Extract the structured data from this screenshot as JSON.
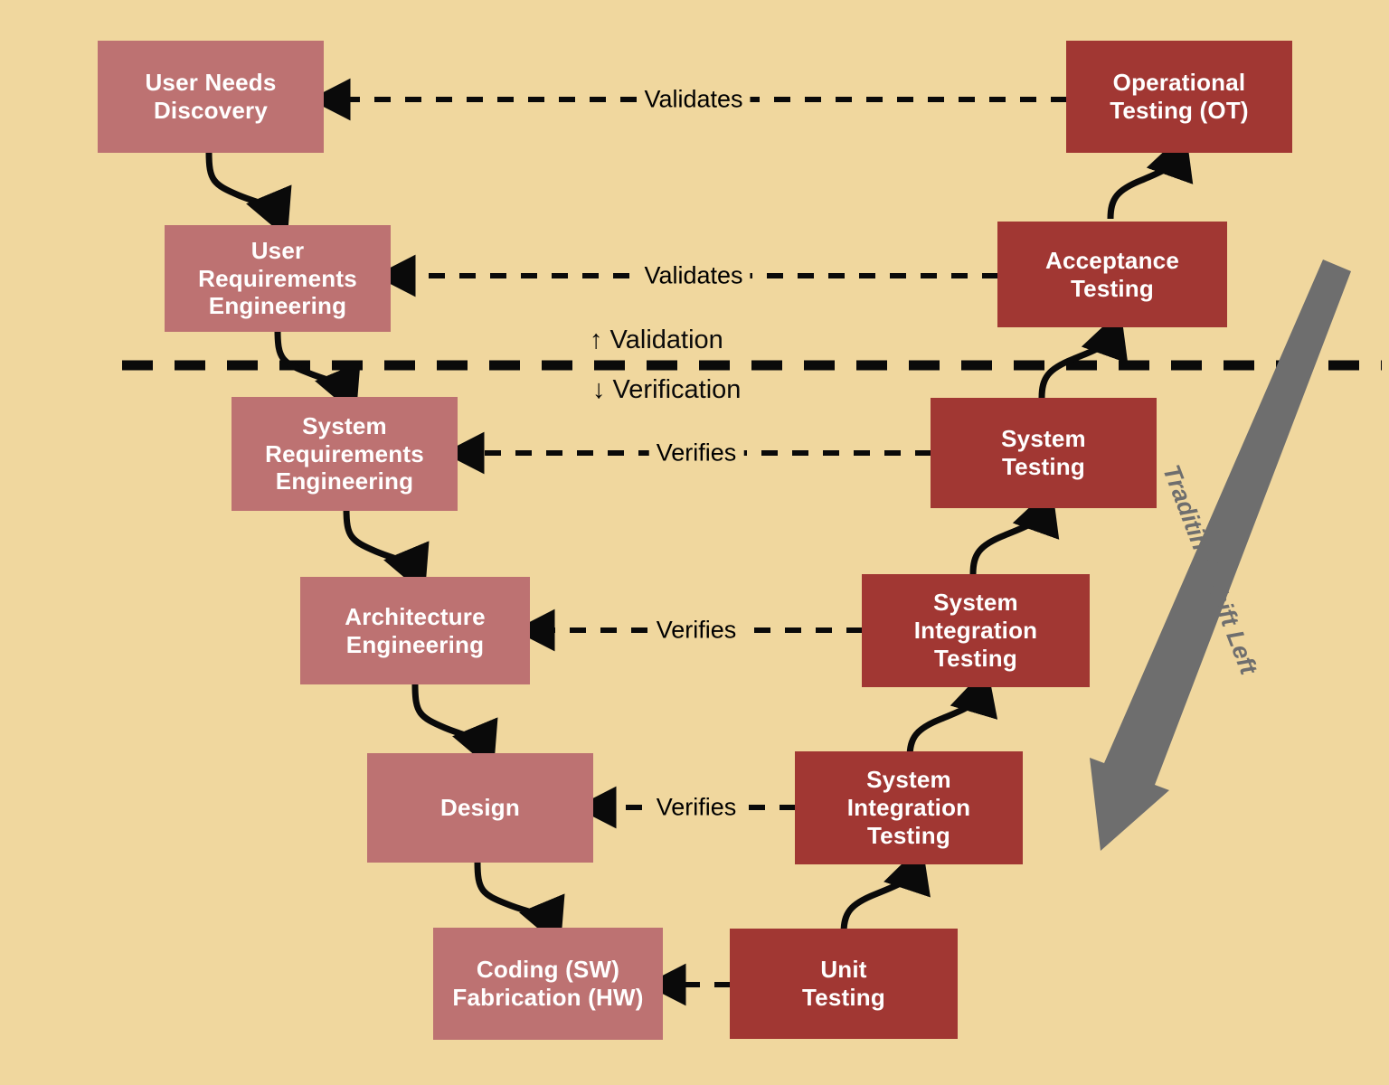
{
  "diagram": {
    "title_label": "",
    "background_color": "#f0d79e",
    "left_node_color": "#bd7272",
    "right_node_color": "#a13733",
    "arrow_color": "#0a0a0a",
    "shift_arrow_color": "#6e6e6e",
    "divider": {
      "above_label": "↑  Validation",
      "below_label": "↓ Verification"
    },
    "left_nodes": [
      {
        "id": "user-needs-discovery",
        "label": "User Needs\nDiscovery"
      },
      {
        "id": "user-requirements-engineering",
        "label": "User\nRequirements\nEngineering"
      },
      {
        "id": "system-requirements-engineering",
        "label": "System\nRequirements\nEngineering"
      },
      {
        "id": "architecture-engineering",
        "label": "Architecture\nEngineering"
      },
      {
        "id": "design",
        "label": "Design"
      },
      {
        "id": "coding-fabrication",
        "label": "Coding (SW)\nFabrication (HW)"
      }
    ],
    "right_nodes": [
      {
        "id": "operational-testing",
        "label": "Operational\nTesting (OT)"
      },
      {
        "id": "acceptance-testing",
        "label": "Acceptance\nTesting"
      },
      {
        "id": "system-testing",
        "label": "System\nTesting"
      },
      {
        "id": "system-integration-testing-1",
        "label": "System\nIntegration\nTesting"
      },
      {
        "id": "system-integration-testing-2",
        "label": "System\nIntegration\nTesting"
      },
      {
        "id": "unit-testing",
        "label": "Unit\nTesting"
      }
    ],
    "cross_links": [
      {
        "id": "link-validates-needs",
        "label": "Validates"
      },
      {
        "id": "link-validates-user-reqs",
        "label": "Validates"
      },
      {
        "id": "link-verifies-system-reqs",
        "label": "Verifies"
      },
      {
        "id": "link-verifies-architecture",
        "label": "Verifies"
      },
      {
        "id": "link-verifies-design",
        "label": "Verifies"
      }
    ],
    "coding_link": {
      "id": "link-unit-to-coding",
      "label": ""
    },
    "shift_arrow": {
      "label": "Traditinal Shift Left"
    }
  }
}
